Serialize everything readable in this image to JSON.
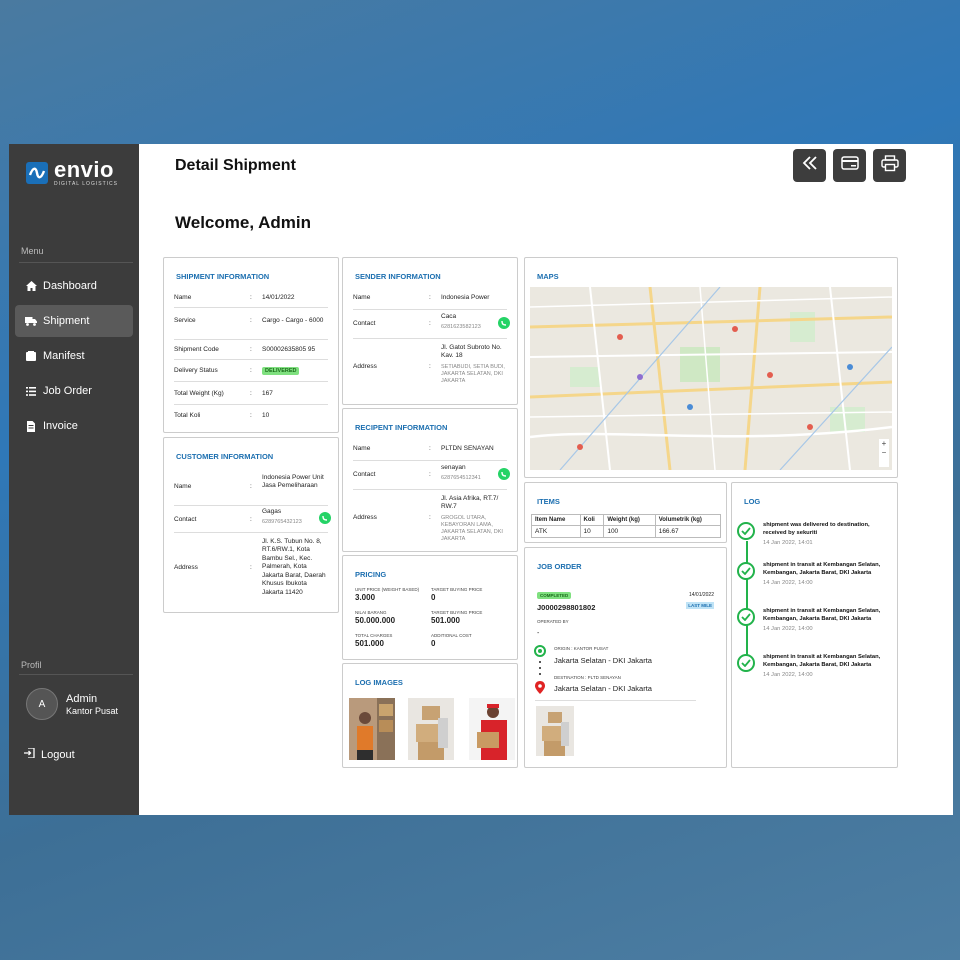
{
  "brand": {
    "name": "envio",
    "tagline": "DIGITAL LOGISTICS"
  },
  "sidebar": {
    "menu_title": "Menu",
    "items": [
      {
        "label": "Dashboard",
        "icon": "home-icon"
      },
      {
        "label": "Shipment",
        "icon": "truck-icon",
        "active": true
      },
      {
        "label": "Manifest",
        "icon": "folder-icon"
      },
      {
        "label": "Job Order",
        "icon": "list-icon"
      },
      {
        "label": "Invoice",
        "icon": "file-icon"
      }
    ],
    "profil_title": "Profil",
    "profile": {
      "initial": "A",
      "name": "Admin",
      "role": "Kantor Pusat"
    },
    "logout_label": "Logout"
  },
  "header": {
    "title": "Detail Shipment",
    "welcome": "Welcome, Admin"
  },
  "shipment_info": {
    "title": "SHIPMENT INFORMATION",
    "rows": [
      {
        "key": "Name",
        "value": "14/01/2022"
      },
      {
        "key": "Service",
        "value": "Cargo - Cargo - 6000"
      },
      {
        "key": "Shipment Code",
        "value": "S00002635805 95"
      },
      {
        "key": "Delivery Status",
        "value": "DELIVERED"
      },
      {
        "key": "Total Weight (Kg)",
        "value": "167"
      },
      {
        "key": "Total Koli",
        "value": "10"
      }
    ]
  },
  "customer_info": {
    "title": "CUSTOMER INFORMATION",
    "name_key": "Name",
    "name_value": "Indonesia Power Unit Jasa Pemeliharaan",
    "contact_key": "Contact",
    "contact_name": "Gagas",
    "contact_phone": "6289765432123",
    "address_key": "Address",
    "address_value": "Jl. K.S. Tubun No. 8, RT.6/RW.1, Kota Bambu Sel., Kec. Palmerah, Kota Jakarta Barat, Daerah Khusus Ibukota Jakarta 11420"
  },
  "sender_info": {
    "title": "SENDER INFORMATION",
    "name_key": "Name",
    "name_value": "Indonesia Power",
    "contact_key": "Contact",
    "contact_name": "Caca",
    "contact_phone": "6281623582123",
    "address_key": "Address",
    "address_main": "Jl. Gatot Subroto No. Kav. 18",
    "address_detail": "SETIABUDI, SETIA BUDI, JAKARTA SELATAN, DKI JAKARTA"
  },
  "recipient_info": {
    "title": "RECIPENT INFORMATION",
    "name_key": "Name",
    "name_value": "PLTDN SENAYAN",
    "contact_key": "Contact",
    "contact_name": "senayan",
    "contact_phone": "6287654512341",
    "address_key": "Address",
    "address_main": "Jl. Asia Afrika, RT.7/ RW.7",
    "address_detail": "GROGOL UTARA, KEBAYORAN LAMA, JAKARTA SELATAN, DKI JAKARTA"
  },
  "pricing": {
    "title": "PRICING",
    "cells": [
      {
        "label": "UNIT PRICE (WEIGHT BASED)",
        "value": "3.000"
      },
      {
        "label": "TARGET BUYING PRICE",
        "value": "0"
      },
      {
        "label": "NILAI BARANG",
        "value": "50.000.000"
      },
      {
        "label": "TARGET BUYING PRICE",
        "value": "501.000"
      },
      {
        "label": "TOTAL CHARGES",
        "value": "501.000"
      },
      {
        "label": "ADDITIONAL COST",
        "value": "0"
      }
    ]
  },
  "log_images": {
    "title": "LOG IMAGES"
  },
  "maps": {
    "title": "MAPS"
  },
  "items": {
    "title": "ITEMS",
    "headers": [
      "Item Name",
      "Koli",
      "Weight (kg)",
      "Volumetrik (kg)"
    ],
    "rows": [
      [
        "ATK",
        "10",
        "100",
        "166.67"
      ]
    ]
  },
  "job_order": {
    "title": "JOB ORDER",
    "status": "COMPLETED",
    "date": "14/01/2022",
    "code": "J0000298801802",
    "type_badge": "LAST MILE",
    "operated_label": "OPERATED BY",
    "operated_value": "-",
    "origin_label": "ORIGIN : KANTOR PUSAT",
    "origin_value": "Jakarta Selatan - DKI Jakarta",
    "destination_label": "DESTINATION : PLTD SENAYAN",
    "destination_value": "Jakarta Selatan - DKI Jakarta"
  },
  "log": {
    "title": "LOG",
    "entries": [
      {
        "text": "shipment was delivered to destination, received by sekuriti",
        "time": "14 Jan 2022, 14:01"
      },
      {
        "text": "shipment in transit at Kembangan Selatan, Kembangan, Jakarta Barat, DKI Jakarta",
        "time": "14 Jan 2022, 14:00"
      },
      {
        "text": "shipment in transit at Kembangan Selatan, Kembangan, Jakarta Barat, DKI Jakarta",
        "time": "14 Jan 2022, 14:00"
      },
      {
        "text": "shipment in transit at Kembangan Selatan, Kembangan, Jakarta Barat, DKI Jakarta",
        "time": "14 Jan 2022, 14:00"
      }
    ]
  },
  "colors": {
    "accent": "#1c6fb0",
    "sidebar": "#3c3c3c",
    "success": "#22b34b",
    "whatsapp": "#25d366"
  }
}
